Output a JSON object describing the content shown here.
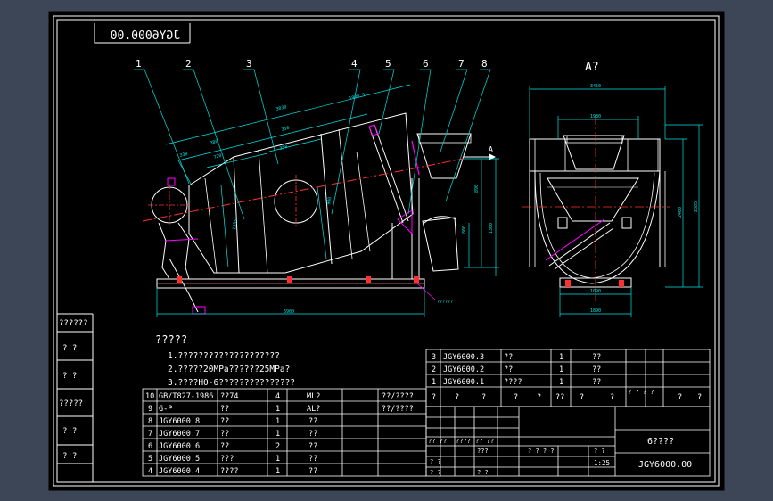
{
  "drawing_number_mirrored": "JGY6000.00",
  "balloon_numbers": [
    "1",
    "2",
    "3",
    "4",
    "5",
    "6",
    "7",
    "8"
  ],
  "view_label": "A?",
  "arrow_label": "A",
  "dimensions": {
    "main_top_1": "3030",
    "main_top_2": "1900.5",
    "main_mid_1": "380",
    "main_mid_2": "350",
    "main_mid_3": "720",
    "main_small_1": "330",
    "main_small_2": "350",
    "main_vertical_1": "1355",
    "main_vertical_2": "900",
    "main_vertical_3": "1300",
    "main_bottom": "6900",
    "side_a_1": "890",
    "side_a_2": "800",
    "side_right_1": "2400",
    "side_right_2": "2885",
    "side_top": "3450",
    "side_mid": "1930",
    "side_bottom": "1890",
    "side_bottom_2": "1090",
    "callout": "??????"
  },
  "left_strip": [
    "??????",
    "?  ?",
    "?  ?",
    "?????",
    "?  ?",
    "?  ?"
  ],
  "notes": {
    "title": "?????",
    "items": [
      "1.????????????????????",
      "2.?????20MPa??????25MPa?",
      "3.????H0-6???????????????"
    ]
  },
  "upper_parts": [
    {
      "no": "3",
      "code": "JGY6000.3",
      "name": "??",
      "qty": "1",
      "mat": "??"
    },
    {
      "no": "2",
      "code": "JGY6000.2",
      "name": "??",
      "qty": "1",
      "mat": "??"
    },
    {
      "no": "1",
      "code": "JGY6000.1",
      "name": "????",
      "qty": "1",
      "mat": "??"
    }
  ],
  "upper_header": [
    "?",
    "?",
    "?",
    "?",
    "?",
    "??",
    "?",
    "?",
    "? ? ? ?",
    "?",
    "?"
  ],
  "lower_parts": [
    {
      "no": "10",
      "code": "GB/T827-1986",
      "name": "??74",
      "qty": "4",
      "mat": "ML2",
      "note": "??/????"
    },
    {
      "no": "9",
      "code": "G-P",
      "name": "??",
      "qty": "1",
      "mat": "AL?",
      "note": "??/????"
    },
    {
      "no": "8",
      "code": "JGY6000.8",
      "name": "??",
      "qty": "1",
      "mat": "??",
      "note": ""
    },
    {
      "no": "7",
      "code": "JGY6000.7",
      "name": "??",
      "qty": "1",
      "mat": "??",
      "note": ""
    },
    {
      "no": "6",
      "code": "JGY6000.6",
      "name": "??",
      "qty": "2",
      "mat": "??",
      "note": ""
    },
    {
      "no": "5",
      "code": "JGY6000.5",
      "name": "???",
      "qty": "1",
      "mat": "??",
      "note": ""
    },
    {
      "no": "4",
      "code": "JGY6000.4",
      "name": "????",
      "qty": "1",
      "mat": "??",
      "note": ""
    }
  ],
  "title_block": {
    "drawing_title": "6????",
    "drawing_number": "JGY6000.00",
    "scale": "1:25",
    "cell_a": "?? ??",
    "cell_b": "????",
    "cell_c": "?? ??",
    "cell_d": "???",
    "cell_e": "? ? ? ?",
    "cell_f": "? ?",
    "cell_g": "? ?",
    "cell_h": "? ?",
    "cell_i": "? ?"
  },
  "colors": {
    "frame": "#ffffff",
    "border": "#ffffff",
    "table": "#ffffff",
    "outline": "#ffffff",
    "centerline": "#ff3030",
    "dimension": "#00e5e5",
    "leader": "#00c8c8",
    "magenta": "#ff00ff",
    "yellow": "#ffff33",
    "text": "#ffffff"
  }
}
